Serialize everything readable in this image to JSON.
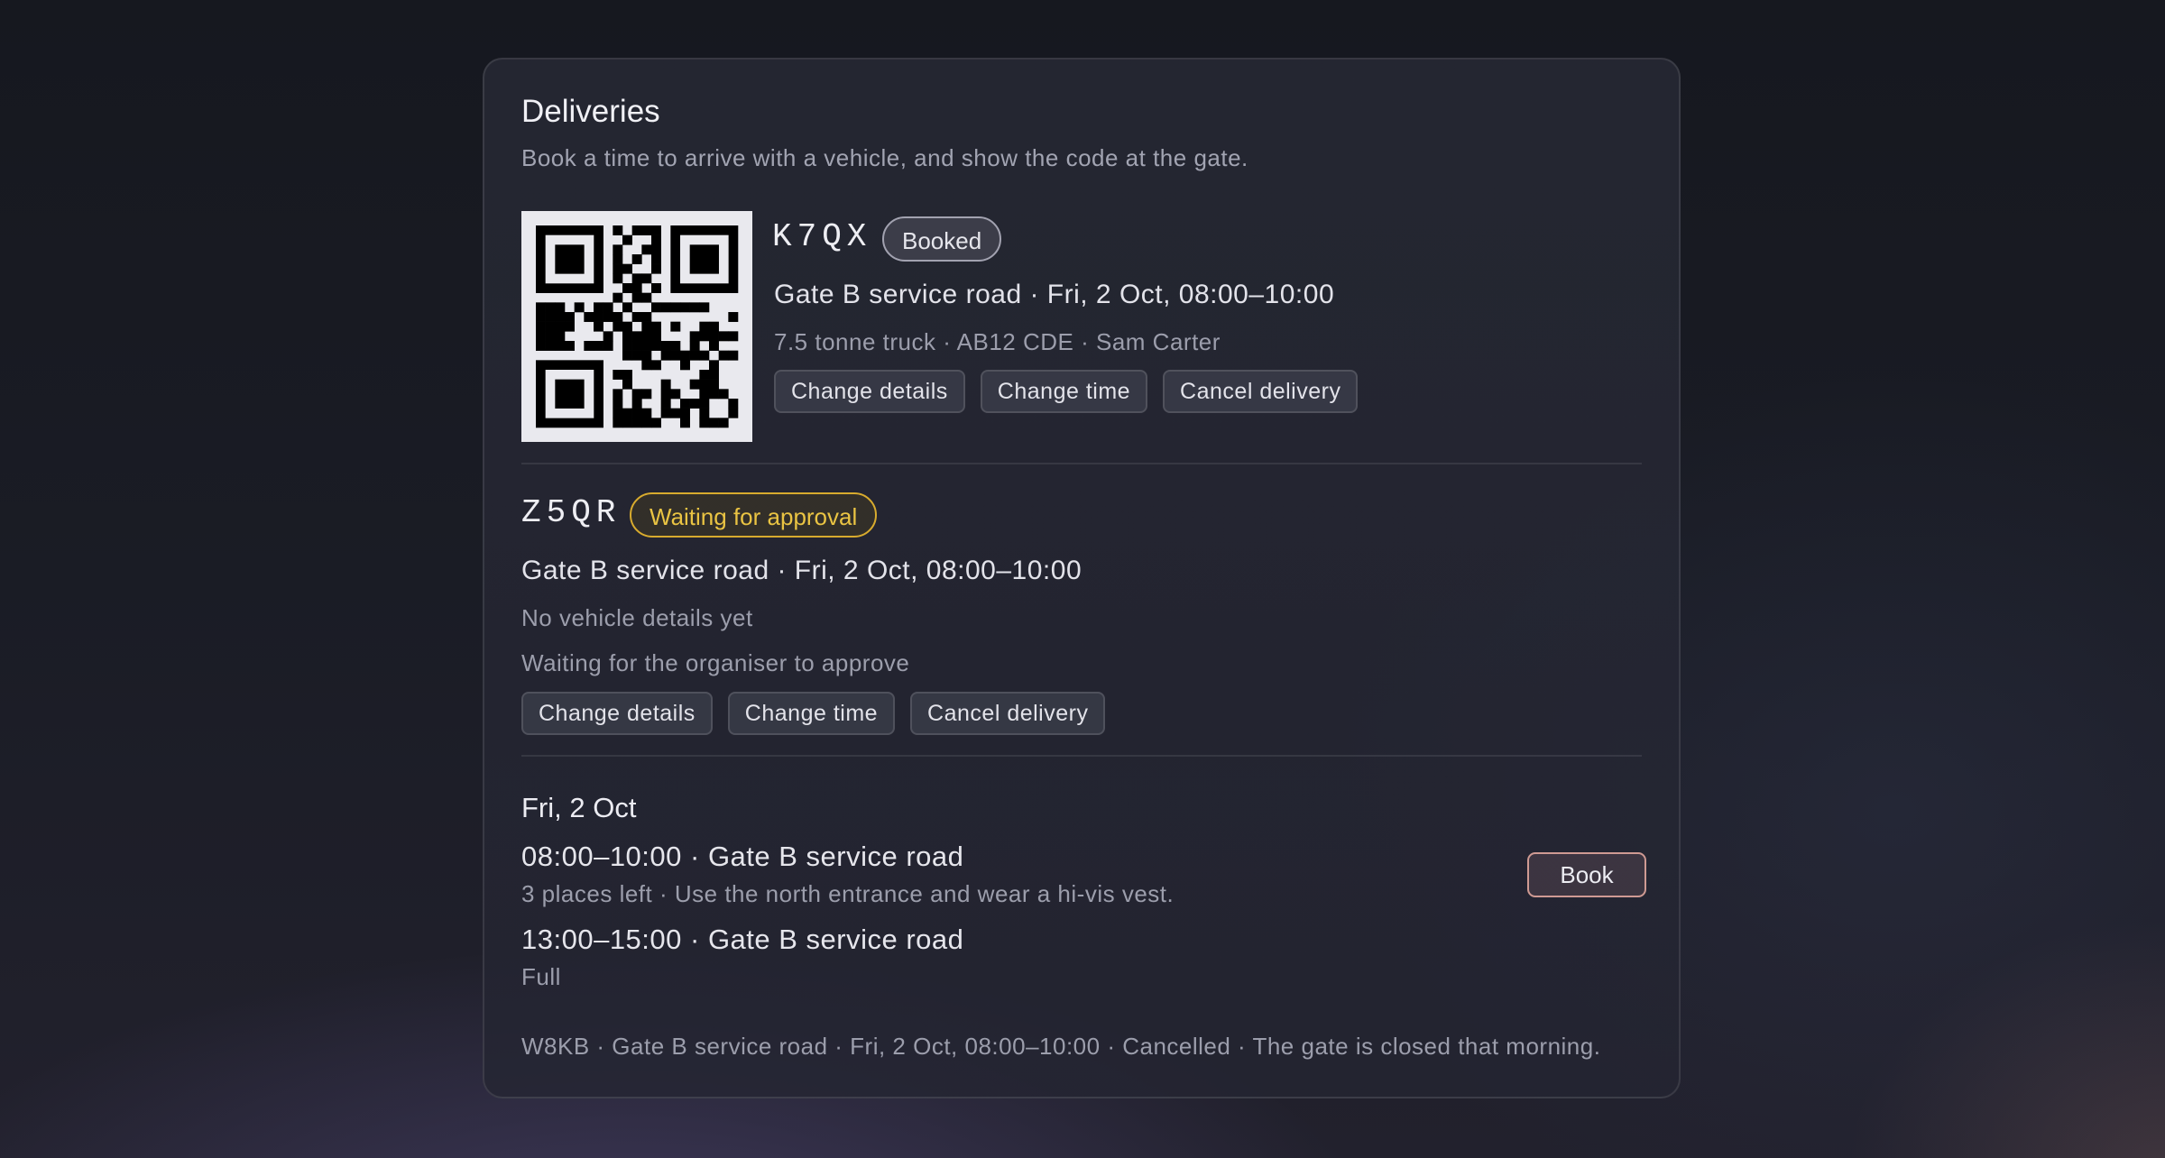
{
  "header": {
    "title": "Deliveries",
    "subtitle": "Book a time to arrive with a vehicle, and show the code at the gate."
  },
  "bookings": [
    {
      "code": "K7QX",
      "status": "Booked",
      "route": "Gate B service road · Fri, 2 Oct, 08:00–10:00",
      "vehicle": "7.5 tonne truck · AB12 CDE · Sam Carter",
      "actions": [
        "Change details",
        "Change time",
        "Cancel delivery"
      ],
      "qr_icon": "qr-code-icon"
    },
    {
      "code": "Z5QR",
      "status": "Waiting for approval",
      "route": "Gate B service road · Fri, 2 Oct, 08:00–10:00",
      "vehicle": "No vehicle details yet",
      "note": "Waiting for the organiser to approve",
      "actions": [
        "Change details",
        "Change time",
        "Cancel delivery"
      ]
    }
  ],
  "schedule": {
    "day": "Fri, 2 Oct",
    "slots": [
      {
        "title": "08:00–10:00 · Gate B service road",
        "detail": "3 places left · Use the north entrance and wear a hi-vis vest.",
        "book_label": "Book"
      },
      {
        "title": "13:00–15:00 · Gate B service road",
        "detail": "Full"
      }
    ]
  },
  "cancelled_note": "W8KB · Gate B service road · Fri, 2 Oct, 08:00–10:00 · Cancelled · The gate is closed that morning.",
  "colors": {
    "background": "#16181f",
    "card": "#282a36",
    "waiting_accent": "#eac443",
    "book_border": "#cf9a93"
  }
}
